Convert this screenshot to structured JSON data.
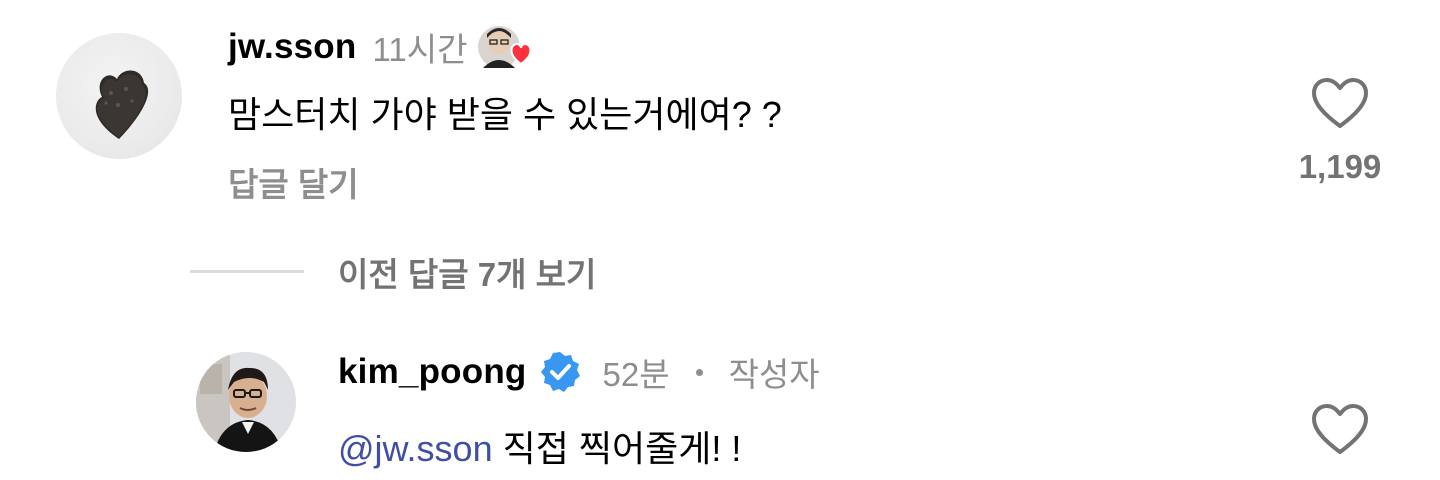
{
  "comments": [
    {
      "username": "jw.sson",
      "time": "11시간",
      "text": "맘스터치 가야 받을 수 있는거에여? ?",
      "reply_label": "답글 달기",
      "like_count": "1,199",
      "liked_by_author": true
    },
    {
      "username": "kim_poong",
      "verified": true,
      "time": "52분",
      "separator": "•",
      "author_badge": "작성자",
      "mention": "@jw.sson",
      "text": " 직접 찍어줄게! !"
    }
  ],
  "view_previous_replies": "이전 답글 7개 보기",
  "colors": {
    "primary_text": "#000000",
    "secondary_text": "#8e8e8e",
    "muted_bold": "#737373",
    "mention": "#3f4fa5",
    "verified_blue": "#3897f0",
    "heart_red": "#ff3040",
    "divider": "#dbdbdb"
  },
  "icons": {
    "like": "heart-outline-icon",
    "liked_by_creator": "creator-heart-icon",
    "verified": "verified-badge-icon"
  }
}
